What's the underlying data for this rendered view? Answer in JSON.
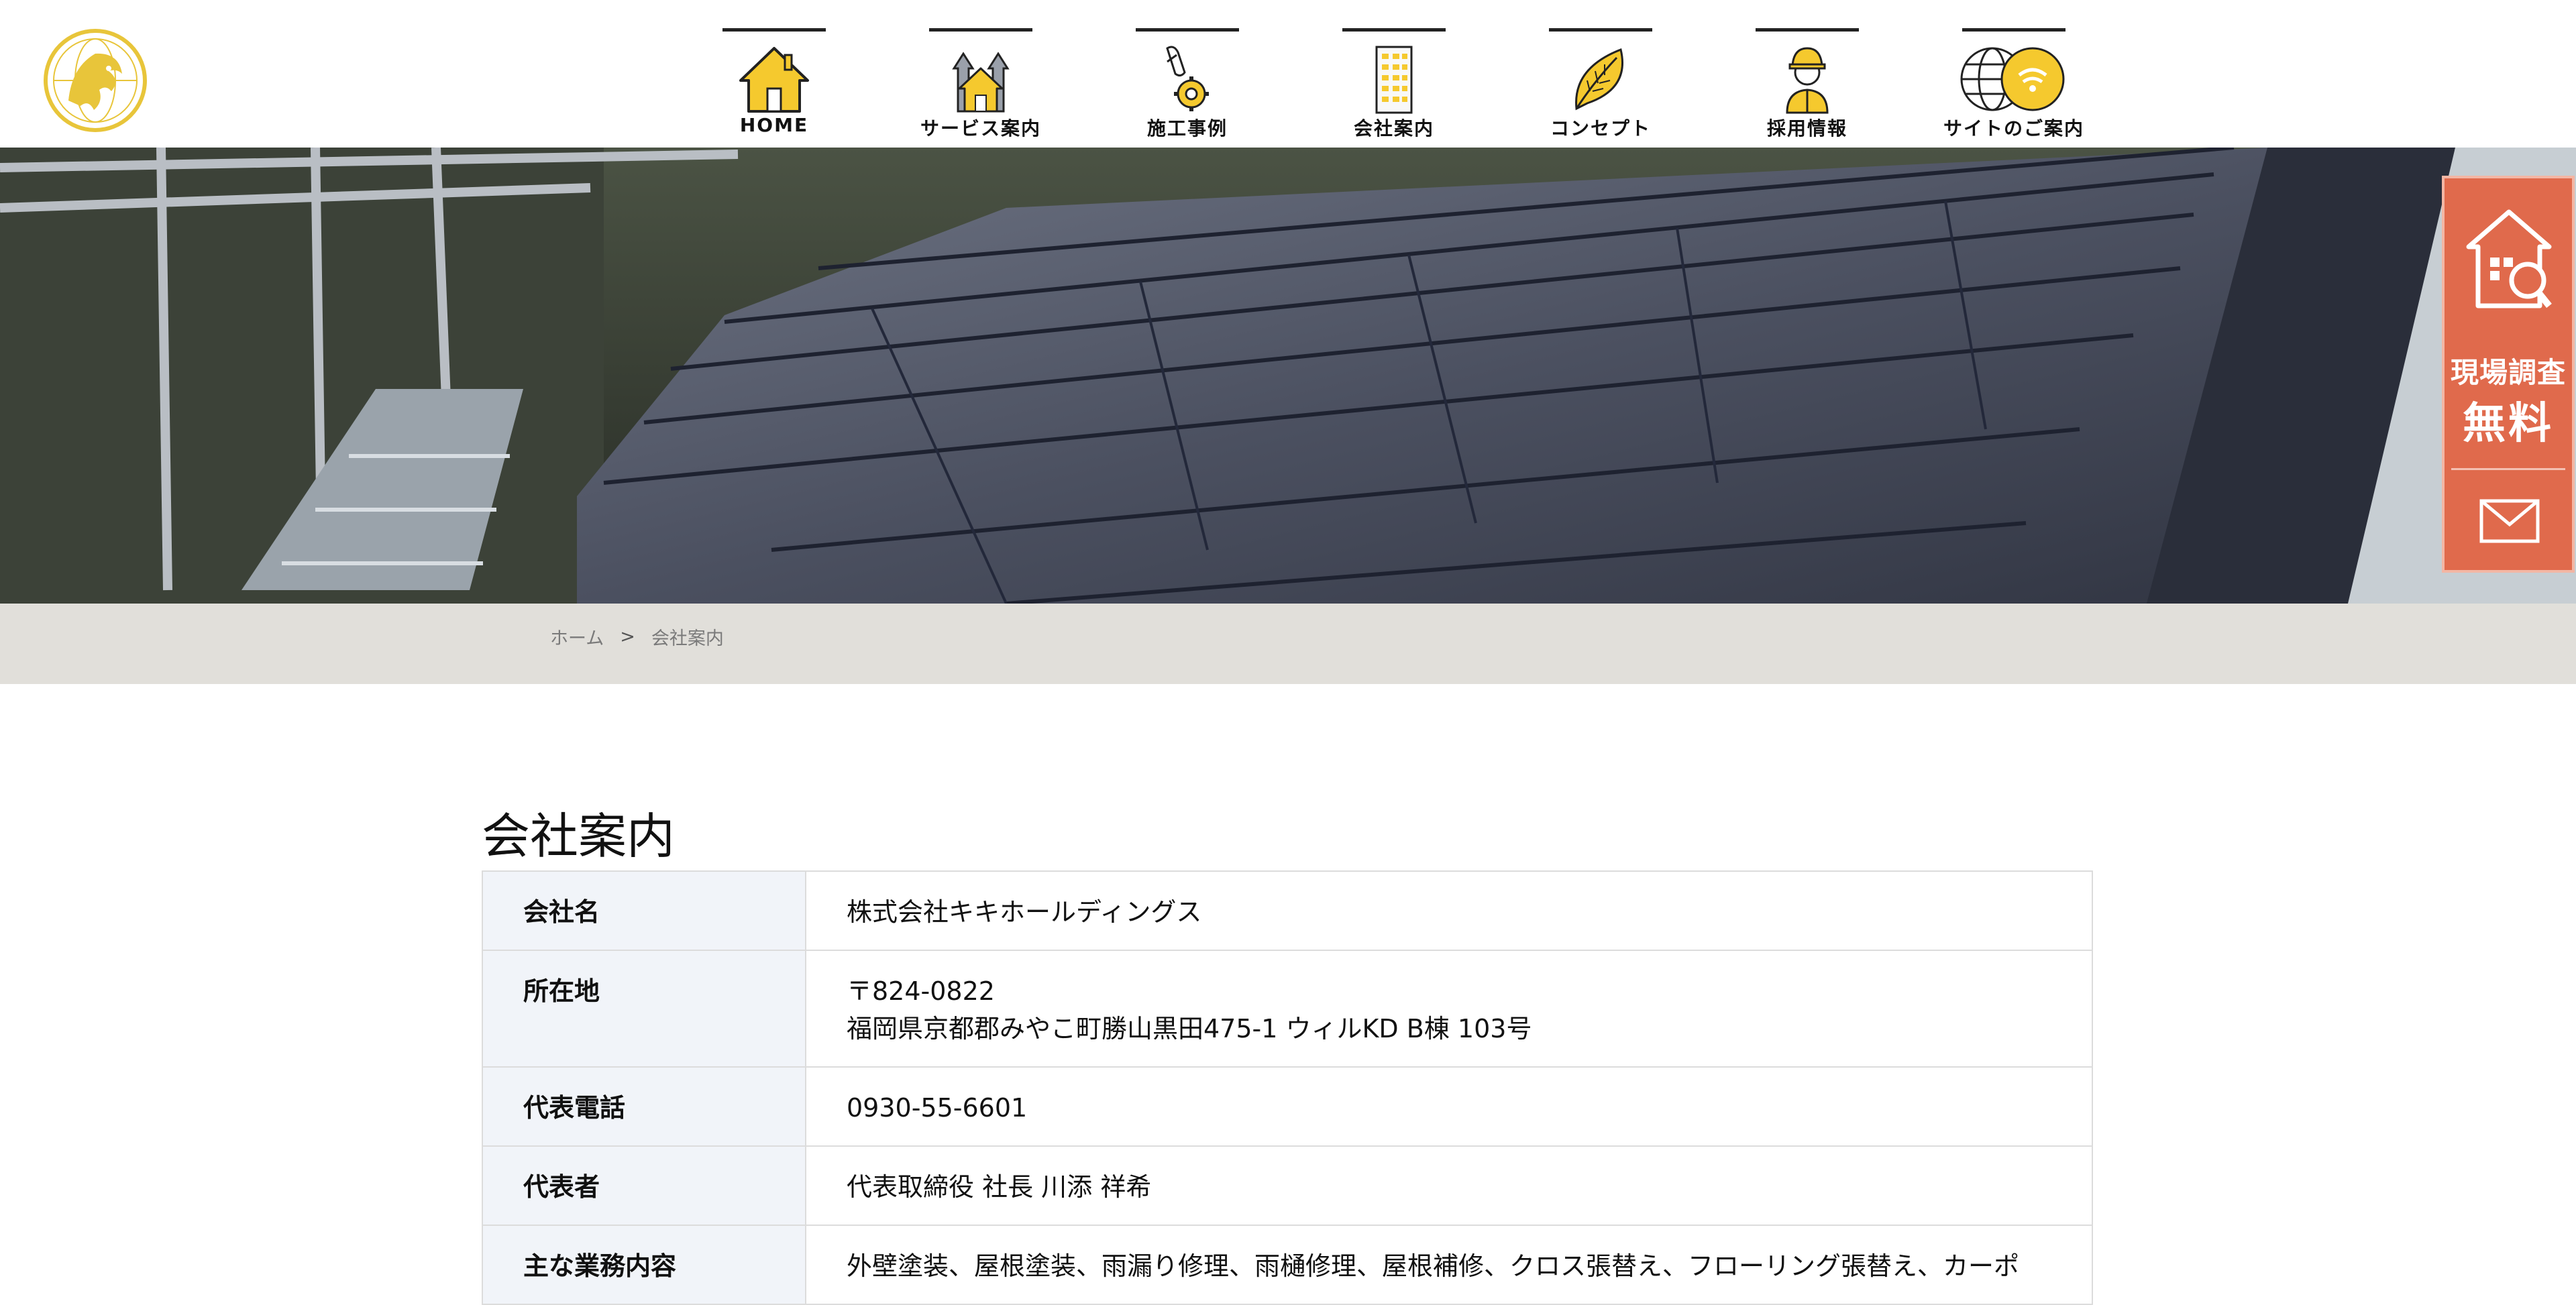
{
  "header": {
    "logo_icon": "lion-globe-logo-icon",
    "nav": [
      {
        "label": "HOME",
        "icon": "house-icon"
      },
      {
        "label": "サービス案内",
        "icon": "service-house-icon"
      },
      {
        "label": "施工事例",
        "icon": "hand-gear-icon"
      },
      {
        "label": "会社案内",
        "icon": "building-icon"
      },
      {
        "label": "コンセプト",
        "icon": "leaf-icon"
      },
      {
        "label": "採用情報",
        "icon": "worker-icon"
      },
      {
        "label": "サイトのご案内",
        "icon": "globe-wifi-icon"
      }
    ]
  },
  "side_cta": {
    "survey_line1": "現場調査",
    "survey_line2": "無料",
    "survey_icon": "house-magnifier-icon",
    "mail_icon": "envelope-icon"
  },
  "breadcrumb": {
    "home": "ホーム",
    "separator": ">",
    "current": "会社案内"
  },
  "page": {
    "title": "会社案内"
  },
  "company_table": {
    "rows": [
      {
        "label": "会社名",
        "lines": [
          "株式会社キキホールディングス"
        ]
      },
      {
        "label": "所在地",
        "lines": [
          "〒824-0822",
          "福岡県京都郡みやこ町勝山黒田475-1 ウィルKD B棟 103号"
        ]
      },
      {
        "label": "代表電話",
        "lines": [
          "0930-55-6601"
        ]
      },
      {
        "label": "代表者",
        "lines": [
          "代表取締役 社長 川添 祥希"
        ]
      },
      {
        "label": "主な業務内容",
        "lines": [
          "外壁塗装、屋根塗装、雨漏り修理、雨樋修理、屋根補修、クロス張替え、フローリング張替え、カーポ"
        ]
      }
    ]
  },
  "colors": {
    "accent_yellow": "#f5c92e",
    "cta_orange": "#e06a4c",
    "breadcrumb_bg": "#e1dfda",
    "table_label_bg": "#f1f4f9"
  }
}
